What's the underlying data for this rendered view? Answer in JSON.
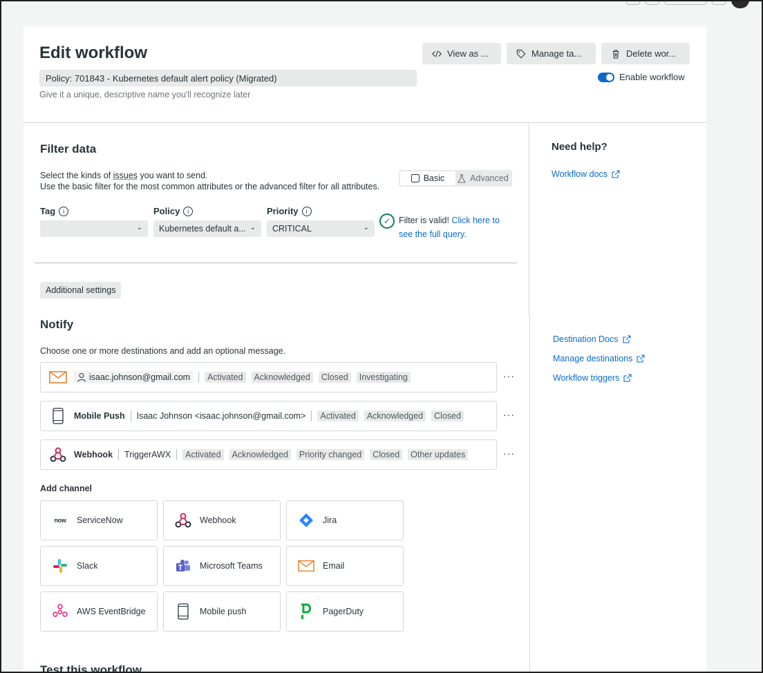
{
  "header": {
    "title": "Edit workflow",
    "name_value": "Policy: 701843 - Kubernetes default alert policy (Migrated)",
    "helper": "Give it a unique, descriptive name you'll recognize later",
    "view_as_label": "View as ...",
    "manage_tags_label": "Manage ta...",
    "delete_label": "Delete wor...",
    "enable_label": "Enable workflow"
  },
  "filter": {
    "title": "Filter data",
    "desc_line1_pre": "Select the kinds of ",
    "desc_line1_link": "issues",
    "desc_line1_post": " you want to send.",
    "desc_line2": "Use the basic filter for the most common attributes or the advanced filter for all attributes.",
    "mode_basic": "Basic",
    "mode_advanced": "Advanced",
    "tag_label": "Tag",
    "tag_value": "",
    "policy_label": "Policy",
    "policy_value": "Kubernetes default a...",
    "priority_label": "Priority",
    "priority_value": "CRITICAL",
    "valid_text": "Filter is valid!",
    "valid_link": "Click here to see the full query."
  },
  "additional_settings_label": "Additional settings",
  "notify": {
    "title": "Notify",
    "desc": "Choose one or more destinations and add an optional message.",
    "destinations": [
      {
        "user": "isaac.johnson@gmail.com",
        "tags": [
          "Activated",
          "Acknowledged",
          "Closed",
          "Investigating"
        ]
      },
      {
        "name": "Mobile Push",
        "target": "Isaac Johnson <isaac.johnson@gmail.com>",
        "tags": [
          "Activated",
          "Acknowledged",
          "Closed"
        ]
      },
      {
        "name": "Webhook",
        "target": "TriggerAWX",
        "tags": [
          "Activated",
          "Acknowledged",
          "Priority changed",
          "Closed",
          "Other updates"
        ]
      }
    ],
    "kebab": "···"
  },
  "add_channel": {
    "title": "Add channel",
    "servicenow_logo": "now",
    "channels": [
      "ServiceNow",
      "Webhook",
      "Jira",
      "Slack",
      "Microsoft Teams",
      "Email",
      "AWS EventBridge",
      "Mobile push",
      "PagerDuty"
    ]
  },
  "test_title": "Test this workflow",
  "help": {
    "title": "Need help?",
    "workflow_docs": "Workflow docs",
    "destination_docs": "Destination Docs",
    "manage_destinations": "Manage destinations",
    "workflow_triggers": "Workflow triggers"
  },
  "colors": {
    "link": "#0b6acb",
    "valid_green": "#0c7d5f",
    "email_orange": "#e8822a",
    "webhook_red": "#c62d5a",
    "jira_blue": "#2684ff",
    "teams_purple": "#5b5fc7",
    "pagerduty_green": "#06ac38"
  }
}
